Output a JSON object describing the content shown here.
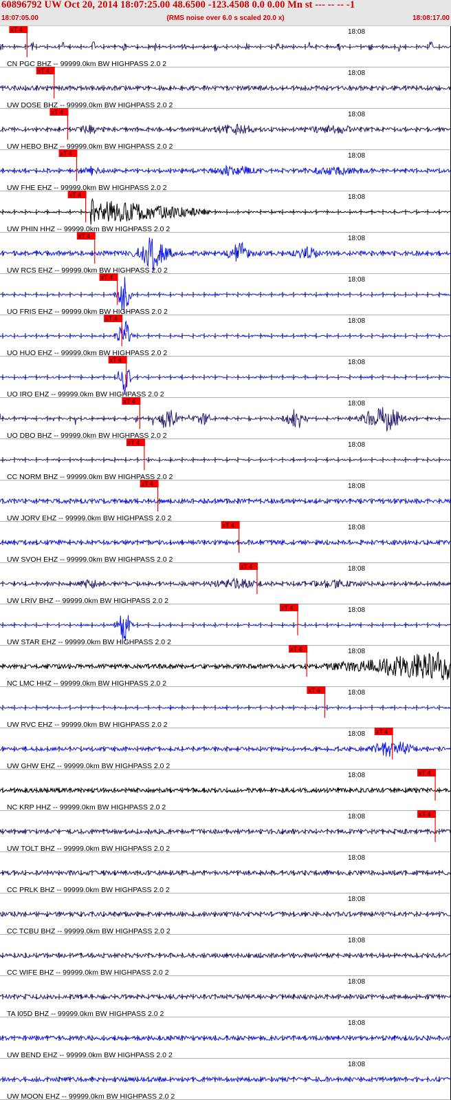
{
  "header": {
    "title": "60896792 UW Oct 20, 2014 18:07:25.00   48.6500 -123.4508  0.0 0.00 Mn st --- -- --  -1",
    "start_time": "18:07:05.00",
    "note": "(RMS noise over 6.0 s scaled 20.0 x)",
    "end_time": "18:08:17.00"
  },
  "chart_data": {
    "type": "line",
    "title": "60896792 UW Oct 20, 2014 18:07:25.00   48.6500 -123.4508  0.0 0.00 Mn st --- -- --  -1",
    "x_range": [
      "18:07:05.00",
      "18:08:17.00"
    ],
    "tick_label": "18:08",
    "pick_label": "xT 4",
    "colors": {
      "purple": "#2a1a6e",
      "blue": "#0b16ee",
      "black": "#000000",
      "pick": "#ff0000",
      "header_text": "#d00000"
    },
    "traces": [
      {
        "label": "CN PGC BHZ -- 99999.0km BW  HIGHPASS  2.0  2",
        "color": "purple",
        "pick_fraction": 0.06,
        "pattern": "spikes"
      },
      {
        "label": "UW DOSE BHZ -- 99999.0km BW  HIGHPASS  2.0  2",
        "color": "purple",
        "pick_fraction": 0.12,
        "pattern": "noise"
      },
      {
        "label": "UW HEBO BHZ -- 99999.0km BW  HIGHPASS  2.0  2",
        "color": "purple",
        "pick_fraction": 0.15,
        "pattern": "bursts"
      },
      {
        "label": "UW FHE EHZ -- 99999.0km BW  HIGHPASS  2.0  2",
        "color": "blue",
        "pick_fraction": 0.17,
        "pattern": "bursts"
      },
      {
        "label": "UW PHIN HHZ -- 99999.0km BW  HIGHPASS  2.0  2",
        "color": "black",
        "pick_fraction": 0.19,
        "pattern": "quake"
      },
      {
        "label": "UW RCS EHZ -- 99999.0km BW  HIGHPASS  2.0  2",
        "color": "blue",
        "pick_fraction": 0.21,
        "pattern": "big-bursts"
      },
      {
        "label": "UO FRIS EHZ -- 99999.0km BW  HIGHPASS  2.0  2",
        "color": "blue",
        "pick_fraction": 0.26,
        "pattern": "single-burst"
      },
      {
        "label": "UO HUO EHZ -- 99999.0km BW  HIGHPASS  2.0  2",
        "color": "blue",
        "pick_fraction": 0.27,
        "pattern": "single-burst"
      },
      {
        "label": "UO IRO EHZ -- 99999.0km BW  HIGHPASS  2.0  2",
        "color": "blue",
        "pick_fraction": 0.28,
        "pattern": "single-burst"
      },
      {
        "label": "UO DBO BHZ -- 99999.0km BW  HIGHPASS  2.0  2",
        "color": "purple",
        "pick_fraction": 0.31,
        "pattern": "multi-burst"
      },
      {
        "label": "CC NORM BHZ -- 99999.0km BW  HIGHPASS  2.0  2",
        "color": "purple",
        "pick_fraction": 0.32,
        "pattern": "quiet"
      },
      {
        "label": "UW JORV EHZ -- 99999.0km BW  HIGHPASS  2.0  2",
        "color": "blue",
        "pick_fraction": 0.35,
        "pattern": "noise"
      },
      {
        "label": "UW SVOH EHZ -- 99999.0km BW  HIGHPASS  2.0  2",
        "color": "blue",
        "pick_fraction": 0.53,
        "pattern": "noise"
      },
      {
        "label": "UW LRIV BHZ -- 99999.0km BW  HIGHPASS  2.0  2",
        "color": "purple",
        "pick_fraction": 0.57,
        "pattern": "bursts"
      },
      {
        "label": "UW STAR EHZ -- 99999.0km BW  HIGHPASS  2.0  2",
        "color": "blue",
        "pick_fraction": 0.66,
        "pattern": "single-burst"
      },
      {
        "label": "NC LMC HHZ -- 99999.0km BW  HIGHPASS  2.0  2",
        "color": "black",
        "pick_fraction": 0.68,
        "pattern": "rising"
      },
      {
        "label": "UW RVC EHZ -- 99999.0km BW  HIGHPASS  2.0  2",
        "color": "blue",
        "pick_fraction": 0.72,
        "pattern": "quiet"
      },
      {
        "label": "UW GHW EHZ -- 99999.0km BW  HIGHPASS  2.0  2",
        "color": "blue",
        "pick_fraction": 0.87,
        "pattern": "late-burst"
      },
      {
        "label": "NC KRP HHZ -- 99999.0km BW  HIGHPASS  2.0  2",
        "color": "black",
        "pick_fraction": 0.965,
        "pattern": "noise"
      },
      {
        "label": "UW TOLT BHZ -- 99999.0km BW  HIGHPASS  2.0  2",
        "color": "purple",
        "pick_fraction": 0.965,
        "pattern": "noise"
      },
      {
        "label": "CC PRLK BHZ -- 99999.0km BW  HIGHPASS  2.0  2",
        "color": "purple",
        "pick_fraction": null,
        "pattern": "noise"
      },
      {
        "label": "CC TCBU BHZ -- 99999.0km BW  HIGHPASS  2.0  2",
        "color": "purple",
        "pick_fraction": null,
        "pattern": "noise"
      },
      {
        "label": "CC WIFE BHZ -- 99999.0km BW  HIGHPASS  2.0  2",
        "color": "purple",
        "pick_fraction": null,
        "pattern": "noise"
      },
      {
        "label": "TA I05D BHZ -- 99999.0km BW  HIGHPASS  2.0  2",
        "color": "purple",
        "pick_fraction": null,
        "pattern": "noise"
      },
      {
        "label": "UW BEND EHZ -- 99999.0km BW  HIGHPASS  2.0  2",
        "color": "blue",
        "pick_fraction": null,
        "pattern": "noise"
      },
      {
        "label": "UW MOON EHZ -- 99999.0km BW  HIGHPASS  2.0  2",
        "color": "blue",
        "pick_fraction": null,
        "pattern": "noise"
      }
    ]
  }
}
